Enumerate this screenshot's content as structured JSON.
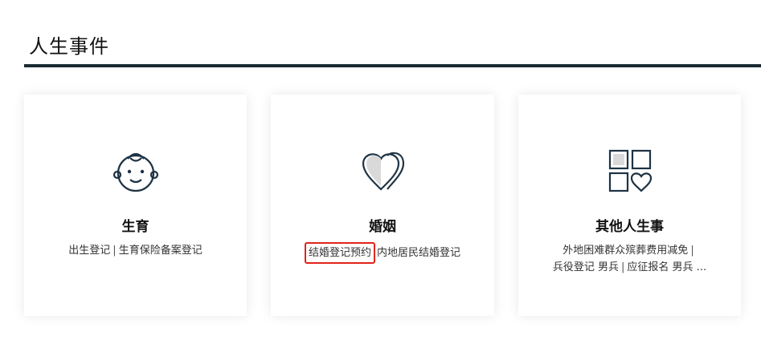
{
  "section": {
    "title": "人生事件"
  },
  "cards": [
    {
      "title": "生育",
      "icon": "baby-face-icon",
      "links": [
        "出生登记",
        "生育保险备案登记"
      ]
    },
    {
      "title": "婚姻",
      "icon": "hearts-icon",
      "links": [
        "结婚登记预约",
        "内地居民结婚登记"
      ]
    },
    {
      "title": "其他人生事",
      "icon": "grid-heart-icon",
      "links": [
        "外地困难群众殡葬费用减免",
        "兵役登记 男兵",
        "应征报名 男兵 ..."
      ]
    }
  ],
  "colors": {
    "accent_rule": "#1a2a33",
    "highlight_border": "#e0241b",
    "icon_stroke": "#1e3344"
  }
}
